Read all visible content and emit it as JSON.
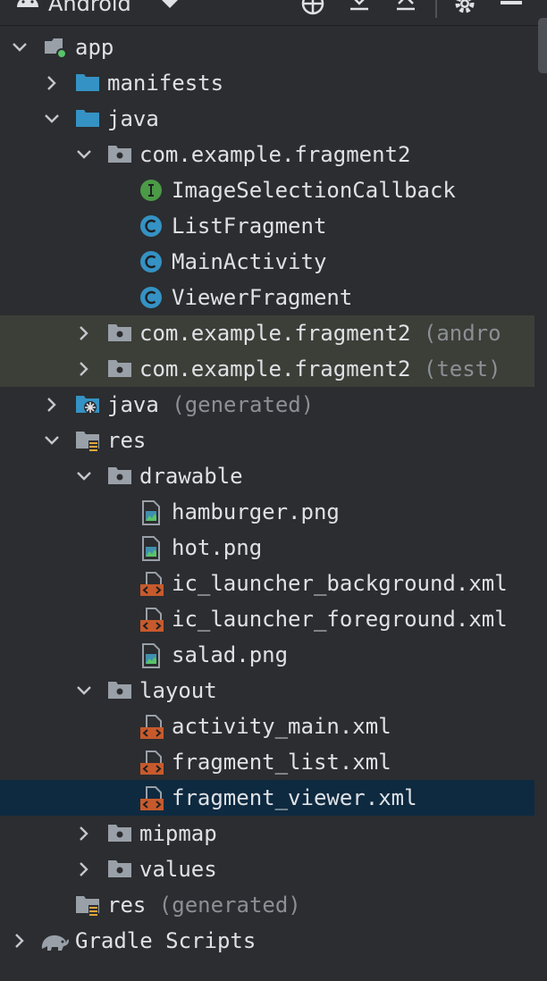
{
  "toolbar": {
    "title": "Android"
  },
  "tree": [
    {
      "label": "app",
      "suffix": "",
      "indent": 0,
      "chevron": "down",
      "icon": "module-folder-icon"
    },
    {
      "label": "manifests",
      "suffix": "",
      "indent": 1,
      "chevron": "right",
      "icon": "folder-blue-icon"
    },
    {
      "label": "java",
      "suffix": "",
      "indent": 1,
      "chevron": "down",
      "icon": "folder-blue-icon"
    },
    {
      "label": "com.example.fragment2",
      "suffix": "",
      "indent": 2,
      "chevron": "down",
      "icon": "package-icon"
    },
    {
      "label": "ImageSelectionCallback",
      "suffix": "",
      "indent": 3,
      "chevron": "none",
      "icon": "interface-icon"
    },
    {
      "label": "ListFragment",
      "suffix": "",
      "indent": 3,
      "chevron": "none",
      "icon": "class-icon"
    },
    {
      "label": "MainActivity",
      "suffix": "",
      "indent": 3,
      "chevron": "none",
      "icon": "class-icon"
    },
    {
      "label": "ViewerFragment",
      "suffix": "",
      "indent": 3,
      "chevron": "none",
      "icon": "class-icon"
    },
    {
      "label": "com.example.fragment2",
      "suffix": "(andro",
      "indent": 2,
      "chevron": "right",
      "icon": "package-icon",
      "highlight": "green"
    },
    {
      "label": "com.example.fragment2",
      "suffix": "(test)",
      "indent": 2,
      "chevron": "right",
      "icon": "package-icon",
      "highlight": "green"
    },
    {
      "label": "java",
      "suffix": "(generated)",
      "indent": 1,
      "chevron": "right",
      "icon": "generated-folder-icon"
    },
    {
      "label": "res",
      "suffix": "",
      "indent": 1,
      "chevron": "down",
      "icon": "res-folder-icon"
    },
    {
      "label": "drawable",
      "suffix": "",
      "indent": 2,
      "chevron": "down",
      "icon": "package-icon"
    },
    {
      "label": "hamburger.png",
      "suffix": "",
      "indent": 3,
      "chevron": "none",
      "icon": "image-file-icon"
    },
    {
      "label": "hot.png",
      "suffix": "",
      "indent": 3,
      "chevron": "none",
      "icon": "image-file-icon"
    },
    {
      "label": "ic_launcher_background.xml",
      "suffix": "",
      "indent": 3,
      "chevron": "none",
      "icon": "xml-file-icon"
    },
    {
      "label": "ic_launcher_foreground.xml",
      "suffix": "",
      "indent": 3,
      "chevron": "none",
      "icon": "xml-file-icon"
    },
    {
      "label": "salad.png",
      "suffix": "",
      "indent": 3,
      "chevron": "none",
      "icon": "image-file-icon"
    },
    {
      "label": "layout",
      "suffix": "",
      "indent": 2,
      "chevron": "down",
      "icon": "package-icon"
    },
    {
      "label": "activity_main.xml",
      "suffix": "",
      "indent": 3,
      "chevron": "none",
      "icon": "xml-file-icon"
    },
    {
      "label": "fragment_list.xml",
      "suffix": "",
      "indent": 3,
      "chevron": "none",
      "icon": "xml-file-icon"
    },
    {
      "label": "fragment_viewer.xml",
      "suffix": "",
      "indent": 3,
      "chevron": "none",
      "icon": "xml-file-icon",
      "selected": true
    },
    {
      "label": "mipmap",
      "suffix": "",
      "indent": 2,
      "chevron": "right",
      "icon": "package-icon"
    },
    {
      "label": "values",
      "suffix": "",
      "indent": 2,
      "chevron": "right",
      "icon": "package-icon"
    },
    {
      "label": "res",
      "suffix": "(generated)",
      "indent": 1,
      "chevron": "none",
      "icon": "res-folder-icon"
    },
    {
      "label": "Gradle Scripts",
      "suffix": "",
      "indent": 0,
      "chevron": "right",
      "icon": "gradle-icon"
    }
  ],
  "colors": {
    "background": "#2b2d30",
    "text": "#dfe1e5",
    "muted": "#8c8f94",
    "selection": "#0e2a40",
    "green_highlight": "#3b3f38",
    "folder_blue": "#3592c4",
    "class_blue": "#3592c4",
    "interface_green": "#4b9a46",
    "xml_orange": "#c75a2c"
  }
}
